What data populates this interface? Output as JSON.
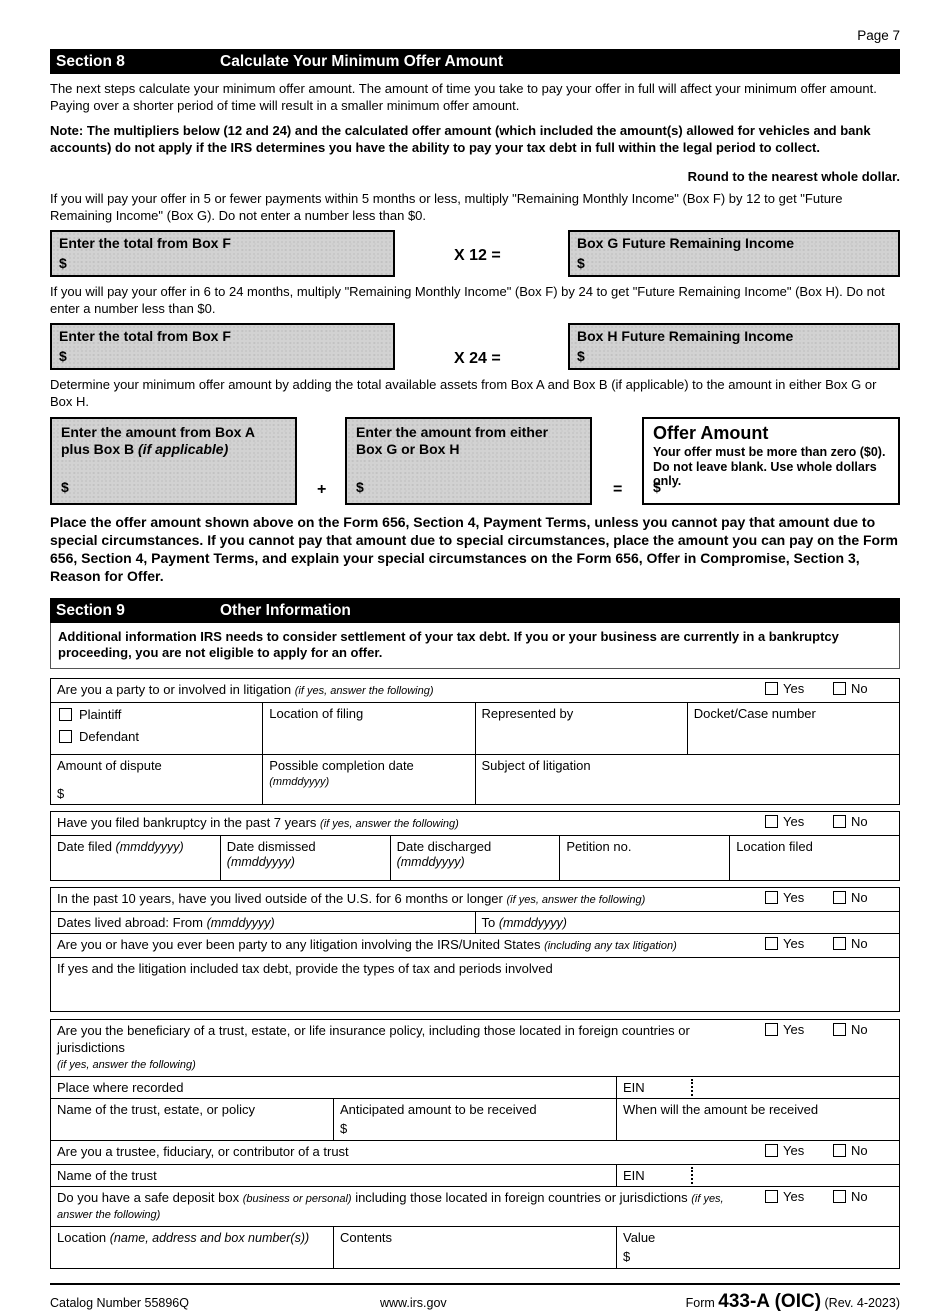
{
  "page_label": "Page 7",
  "section8": {
    "number": "Section 8",
    "title": "Calculate Your Minimum Offer Amount",
    "intro": "The next steps calculate your minimum offer amount. The amount of time you take to pay your offer in full will affect your minimum offer amount. Paying over a shorter period of time will result in a smaller minimum offer amount.",
    "note": "Note: The multipliers below (12 and 24) and the calculated offer amount (which included the amount(s) allowed for vehicles and bank accounts) do not apply if the IRS determines you have the ability to pay your tax debt in full within the legal period to collect.",
    "round_note": "Round to the nearest whole dollar.",
    "instr_12": "If you will pay your offer in 5 or fewer payments within 5 months or less, multiply \"Remaining Monthly Income\" (Box F)  by 12 to get \"Future Remaining Income\" (Box G). Do not enter a number less than $0.",
    "box_f_1_label": "Enter the total from Box F",
    "multiplier_12": "X 12  =",
    "box_g_label": "Box G Future Remaining Income",
    "instr_24": "If you will pay your offer in 6 to 24 months, multiply \"Remaining Monthly Income\" (Box F) by 24 to get \"Future Remaining Income\" (Box H). Do not enter a number less than $0.",
    "box_f_2_label": "Enter the total from Box F",
    "multiplier_24": "X 24  =",
    "box_h_label": "Box H Future Remaining Income",
    "instr_total": "Determine your minimum offer amount by adding the total available assets from Box A and Box B (if applicable) to the amount in either Box G or Box H.",
    "box_ab_label_line1": "Enter the amount from Box A",
    "box_ab_label_line2_plain": "plus Box B ",
    "box_ab_label_line2_italic": "(if applicable)",
    "plus_sign": "+",
    "box_gh_label_line1": "Enter the amount from either",
    "box_gh_label_line2": "Box G or Box H",
    "equals_sign": "=",
    "offer_title": "Offer Amount",
    "offer_sub": "Your offer must be more than zero ($0). Do not leave blank. Use whole dollars only.",
    "dollar": "$",
    "closing": "Place the offer amount shown above on the Form 656, Section 4, Payment Terms, unless you cannot pay that amount due to special circumstances. If you cannot pay that amount due to special circumstances, place the amount you can pay on the Form 656, Section 4, Payment Terms, and explain your special circumstances on the Form 656, Offer in Compromise, Section 3, Reason for Offer."
  },
  "section9": {
    "number": "Section 9",
    "title": "Other Information",
    "intro": "Additional information IRS needs to  consider settlement of your tax debt. If you or your business are currently in a bankruptcy proceeding, you are not eligible to apply for an offer.",
    "yes": "Yes",
    "no": "No",
    "dollar": "$",
    "q_litigation": "Are you a party to or involved in litigation ",
    "q_litigation_it": "(if yes, answer the following)",
    "plaintiff": "Plaintiff",
    "defendant": "Defendant",
    "location_of_filing": "Location of filing",
    "represented_by": "Represented by",
    "docket_case_number": "Docket/Case number",
    "amount_of_dispute": "Amount of dispute",
    "possible_completion_date": "Possible completion date ",
    "possible_completion_date_it": "(mmddyyyy)",
    "subject_of_litigation": "Subject of litigation",
    "q_bankruptcy": "Have you filed bankruptcy in the past 7 years ",
    "q_bankruptcy_it": "(if yes, answer the following)",
    "date_filed": "Date filed ",
    "date_filed_it": "(mmddyyyy)",
    "date_dismissed": "Date dismissed ",
    "date_dismissed_it": "(mmddyyyy)",
    "date_discharged": "Date discharged ",
    "date_discharged_it": "(mmddyyyy)",
    "petition_no": "Petition no.",
    "location_filed": "Location filed",
    "q_abroad": "In the past 10 years, have you lived outside of the U.S. for 6 months or longer ",
    "q_abroad_it": "(if yes, answer the following)",
    "dates_abroad_from": "Dates lived abroad: From ",
    "dates_abroad_from_it": "(mmddyyyy)",
    "dates_abroad_to": "To ",
    "dates_abroad_to_it": "(mmddyyyy)",
    "q_irs_litigation": "Are you or have you ever been party to any litigation involving the IRS/United States ",
    "q_irs_litigation_it": "(including any tax litigation)",
    "tax_debt_types": "If yes and the litigation included tax debt, provide the types of tax and periods involved",
    "q_beneficiary": "Are you the beneficiary of a trust, estate, or life insurance policy, including those located in foreign countries or jurisdictions",
    "q_beneficiary_it": "(if yes, answer the following)",
    "place_where_recorded": "Place where recorded",
    "ein": "EIN",
    "name_trust_estate_policy": "Name of the trust, estate, or policy",
    "anticipated_amount": "Anticipated amount to be received",
    "when_received": "When will the amount be received",
    "q_trustee": "Are you a trustee, fiduciary, or contributor of a trust",
    "name_of_trust": "Name of the trust",
    "q_safe_deposit": "Do you have a safe deposit box ",
    "q_safe_deposit_it1": "(business or personal)",
    "q_safe_deposit_mid": " including those located in foreign countries or jurisdictions ",
    "q_safe_deposit_it2": "(if yes, answer the following)",
    "location_box": "Location ",
    "location_box_it": "(name, address and box number(s))",
    "contents": "Contents",
    "value": "Value"
  },
  "footer": {
    "catalog": "Catalog Number 55896Q",
    "url": "www.irs.gov",
    "form_prefix": "Form ",
    "form_number": "433-A (OIC)",
    "form_rev": " (Rev. 4-2023)"
  }
}
